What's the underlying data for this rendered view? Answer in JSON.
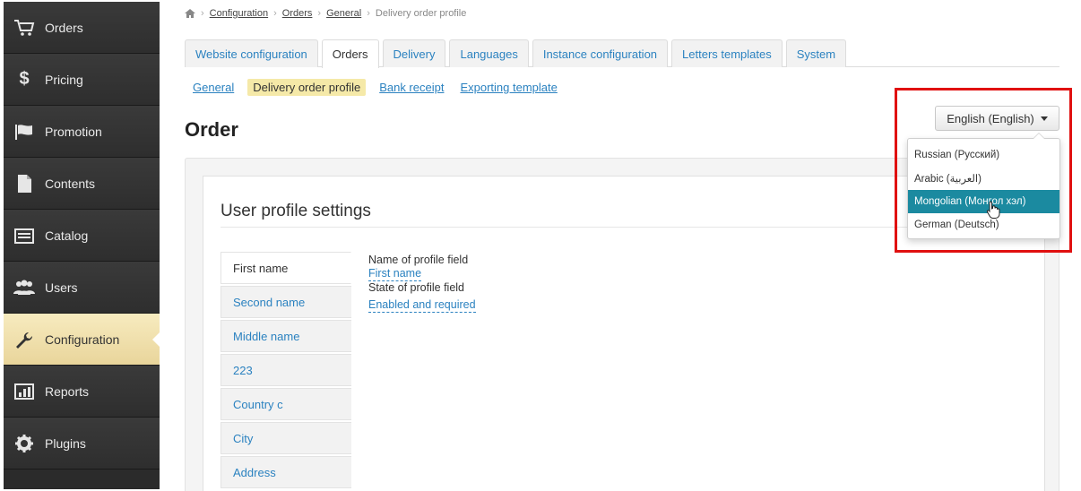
{
  "sidebar": {
    "items": [
      {
        "label": "Orders",
        "icon": "cart-icon"
      },
      {
        "label": "Pricing",
        "icon": "dollar-icon"
      },
      {
        "label": "Promotion",
        "icon": "flag-icon"
      },
      {
        "label": "Contents",
        "icon": "document-icon"
      },
      {
        "label": "Catalog",
        "icon": "list-icon"
      },
      {
        "label": "Users",
        "icon": "users-icon"
      },
      {
        "label": "Configuration",
        "icon": "wrench-icon"
      },
      {
        "label": "Reports",
        "icon": "bar-chart-icon"
      },
      {
        "label": "Plugins",
        "icon": "gear-icon"
      }
    ],
    "active": "Configuration"
  },
  "breadcrumb": {
    "items": [
      "Configuration",
      "Orders",
      "General"
    ],
    "current": "Delivery order profile"
  },
  "tabs": [
    {
      "label": "Website configuration"
    },
    {
      "label": "Orders"
    },
    {
      "label": "Delivery"
    },
    {
      "label": "Languages"
    },
    {
      "label": "Instance configuration"
    },
    {
      "label": "Letters templates"
    },
    {
      "label": "System"
    }
  ],
  "subnav": [
    {
      "label": "General"
    },
    {
      "label": "Delivery order profile"
    },
    {
      "label": "Bank receipt"
    },
    {
      "label": "Exporting template"
    }
  ],
  "page_title": "Order",
  "section_title": "User profile settings",
  "fields": [
    {
      "label": "First name"
    },
    {
      "label": "Second name"
    },
    {
      "label": "Middle name"
    },
    {
      "label": "223"
    },
    {
      "label": "Country c"
    },
    {
      "label": "City"
    },
    {
      "label": "Address"
    }
  ],
  "details": {
    "name_label": "Name of profile field",
    "name_value": "First name",
    "state_label": "State of profile field",
    "state_value": "Enabled and required"
  },
  "language": {
    "selected": "English (English)",
    "options": [
      {
        "label": "Russian (Русский)"
      },
      {
        "label": "Arabic (العربية)"
      },
      {
        "label": "Mongolian (Монгол хэл)"
      },
      {
        "label": "German (Deutsch)"
      }
    ],
    "hovered": "Mongolian (Монгол хэл)"
  },
  "colors": {
    "sidebar_bg": "#2b2b2b",
    "active_sidebar": "#f1e2ad",
    "link": "#2b82c0",
    "hover_option": "#1b8aa0",
    "highlight": "#e01010"
  }
}
